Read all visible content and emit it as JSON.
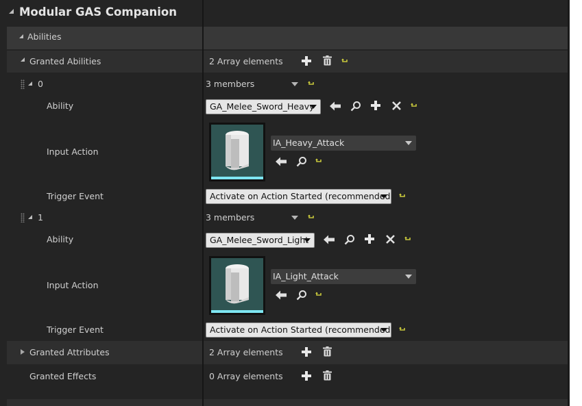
{
  "panel": {
    "title": "Modular GAS Companion",
    "category": "Abilities"
  },
  "granted_abilities": {
    "label": "Granted Abilities",
    "count_text": "2 Array elements",
    "elements": [
      {
        "index": "0",
        "members_text": "3 members",
        "ability": {
          "label": "Ability",
          "value": "GA_Melee_Sword_Heavy"
        },
        "input_action": {
          "label": "Input Action",
          "value": "IA_Heavy_Attack"
        },
        "trigger_event": {
          "label": "Trigger Event",
          "value": "Activate on Action Started (recommended)"
        }
      },
      {
        "index": "1",
        "members_text": "3 members",
        "ability": {
          "label": "Ability",
          "value": "GA_Melee_Sword_Light"
        },
        "input_action": {
          "label": "Input Action",
          "value": "IA_Light_Attack"
        },
        "trigger_event": {
          "label": "Trigger Event",
          "value": "Activate on Action Started (recommended)"
        }
      }
    ]
  },
  "granted_attributes": {
    "label": "Granted Attributes",
    "count_text": "2 Array elements"
  },
  "granted_effects": {
    "label": "Granted Effects",
    "count_text": "0 Array elements"
  },
  "icons": {
    "add": "plus-icon",
    "delete": "trash-icon",
    "reset": "reset-arrow-icon",
    "use_selected": "left-arrow-icon",
    "browse": "magnifier-icon",
    "clear": "x-icon",
    "expand": "triangle-icon",
    "drag": "grip-icon"
  },
  "colors": {
    "background": "#242424",
    "row_alt": "#2e2e2e",
    "accent_reset": "#c8c83c",
    "thumb_bg": "#2f5553",
    "thumb_bar": "#7ee6f2"
  }
}
